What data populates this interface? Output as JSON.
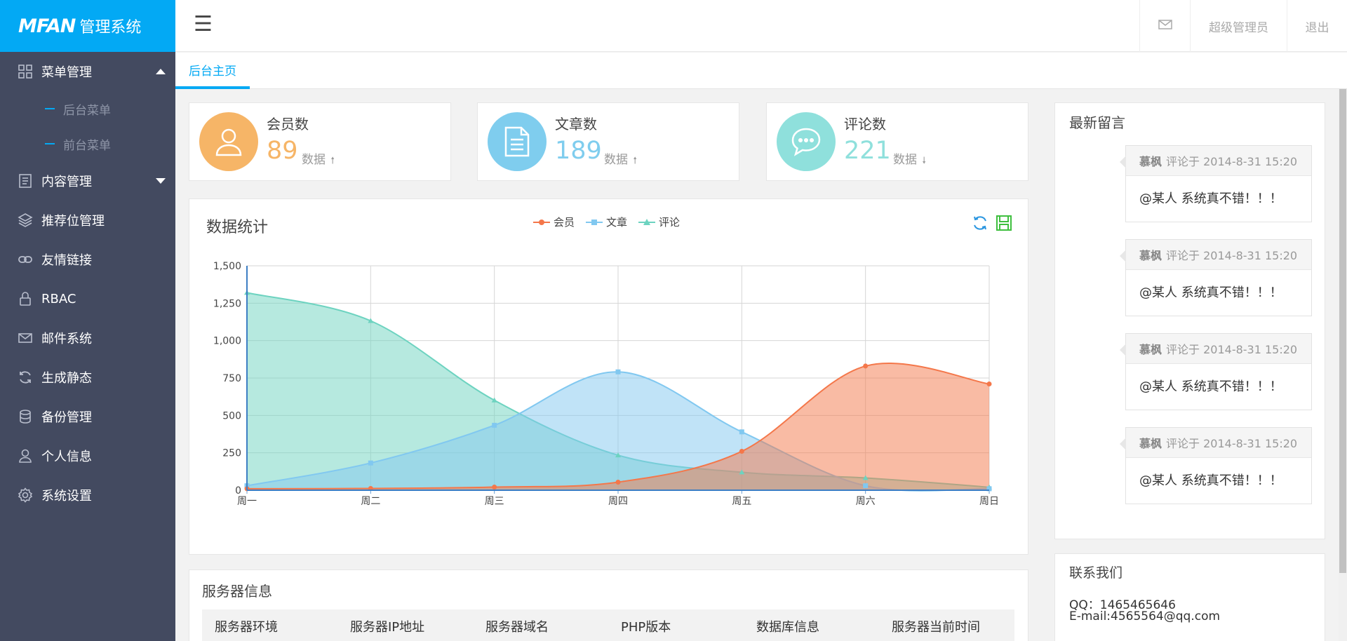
{
  "logo": {
    "brand": "MFAN",
    "subtitle": "管理系统"
  },
  "sidebar": {
    "items": [
      {
        "label": "菜单管理",
        "icon": "grid-icon",
        "expanded": true,
        "children": [
          "后台菜单",
          "前台菜单"
        ]
      },
      {
        "label": "内容管理",
        "icon": "document-icon"
      },
      {
        "label": "推荐位管理",
        "icon": "layers-icon"
      },
      {
        "label": "友情链接",
        "icon": "link-icon"
      },
      {
        "label": "RBAC",
        "icon": "lock-icon"
      },
      {
        "label": "邮件系统",
        "icon": "mail-icon"
      },
      {
        "label": "生成静态",
        "icon": "refresh-icon"
      },
      {
        "label": "备份管理",
        "icon": "database-icon"
      },
      {
        "label": "个人信息",
        "icon": "user-icon"
      },
      {
        "label": "系统设置",
        "icon": "gear-icon"
      }
    ]
  },
  "header": {
    "user": "超级管理员",
    "logout": "退出",
    "mail_icon": "mail-icon",
    "menu_icon": "hamburger-icon"
  },
  "tabs": {
    "active": "后台主页"
  },
  "stats": [
    {
      "label": "会员数",
      "value": "89",
      "note": "数据",
      "trend": "up",
      "color": "#f6b567",
      "icon": "user-icon"
    },
    {
      "label": "文章数",
      "value": "189",
      "note": "数据",
      "trend": "up",
      "color": "#7fcdee",
      "icon": "document-icon"
    },
    {
      "label": "评论数",
      "value": "221",
      "note": "数据",
      "trend": "down",
      "color": "#8fe0dc",
      "icon": "chat-icon"
    }
  ],
  "arrows": {
    "up": "🠕",
    "down": "🠗"
  },
  "chart_panel": {
    "title": "数据统计"
  },
  "chart_data": {
    "type": "area",
    "categories": [
      "周一",
      "周二",
      "周三",
      "周四",
      "周五",
      "周六",
      "周日"
    ],
    "ylim": [
      0,
      1500
    ],
    "yticks": [
      "0",
      "250",
      "500",
      "750",
      "1,000",
      "1,250",
      "1,500"
    ],
    "series": [
      {
        "name": "会员",
        "values": [
          10,
          12,
          21,
          54,
          260,
          830,
          710
        ],
        "color": "#f4774a"
      },
      {
        "name": "文章",
        "values": [
          30,
          182,
          434,
          791,
          390,
          30,
          10
        ],
        "color": "#81c8f0"
      },
      {
        "name": "评论",
        "values": [
          1320,
          1132,
          601,
          234,
          120,
          82,
          20
        ],
        "color": "#6dd3c0"
      }
    ],
    "legend_position": "top-center",
    "grid": true
  },
  "messages_panel": {
    "title": "最新留言",
    "items": [
      {
        "author": "慕枫",
        "meta": "评论于 2014-8-31 15:20",
        "text": "@某人 系统真不错！！！"
      },
      {
        "author": "慕枫",
        "meta": "评论于 2014-8-31 15:20",
        "text": "@某人 系统真不错！！！"
      },
      {
        "author": "慕枫",
        "meta": "评论于 2014-8-31 15:20",
        "text": "@某人 系统真不错！！！"
      },
      {
        "author": "慕枫",
        "meta": "评论于 2014-8-31 15:20",
        "text": "@某人 系统真不错！！！"
      }
    ]
  },
  "server_panel": {
    "title": "服务器信息",
    "columns": [
      "服务器环境",
      "服务器IP地址",
      "服务器域名",
      "PHP版本",
      "数据库信息",
      "服务器当前时间"
    ]
  },
  "contact_panel": {
    "title": "联系我们",
    "qq": "QQ：1465465646",
    "email": "E-mail:4565564@qq.com"
  }
}
